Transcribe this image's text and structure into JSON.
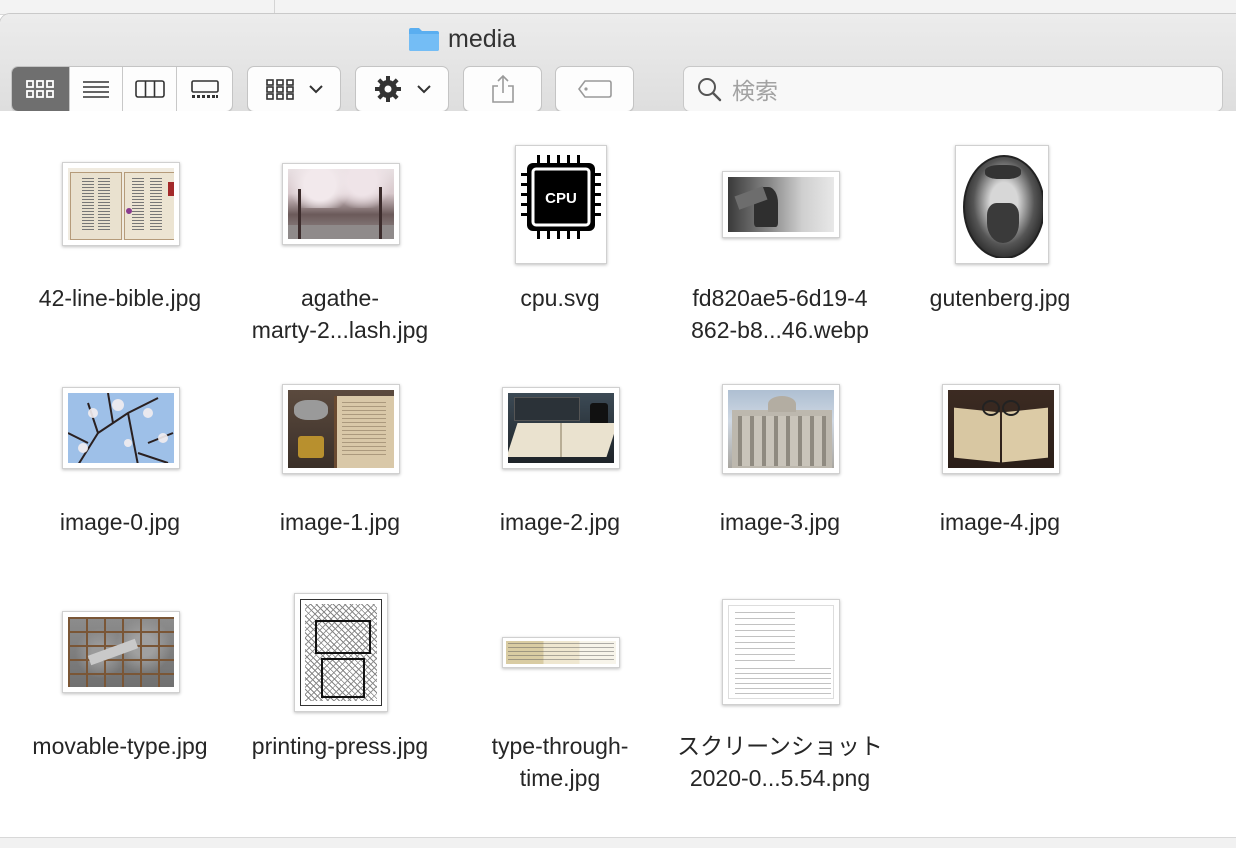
{
  "window": {
    "title": "media"
  },
  "toolbar": {
    "view_modes": [
      "icon-view",
      "list-view",
      "column-view",
      "gallery-view"
    ],
    "search_placeholder": "検索"
  },
  "files": [
    {
      "name": "42-line-bible.jpg"
    },
    {
      "name": "agathe-\nmarty-2...lash.jpg"
    },
    {
      "name": "cpu.svg",
      "thumb_text": "CPU"
    },
    {
      "name": "fd820ae5-6d19-4\n862-b8...46.webp"
    },
    {
      "name": "gutenberg.jpg"
    },
    {
      "name": "image-0.jpg"
    },
    {
      "name": "image-1.jpg"
    },
    {
      "name": "image-2.jpg"
    },
    {
      "name": "image-3.jpg"
    },
    {
      "name": "image-4.jpg"
    },
    {
      "name": "movable-type.jpg"
    },
    {
      "name": "printing-press.jpg"
    },
    {
      "name": "type-through-\ntime.jpg"
    },
    {
      "name": "スクリーンショット\n2020-0...5.54.png"
    }
  ],
  "colors": {
    "folder": "#5aaef0",
    "active_segment": "#6f6f6f"
  }
}
